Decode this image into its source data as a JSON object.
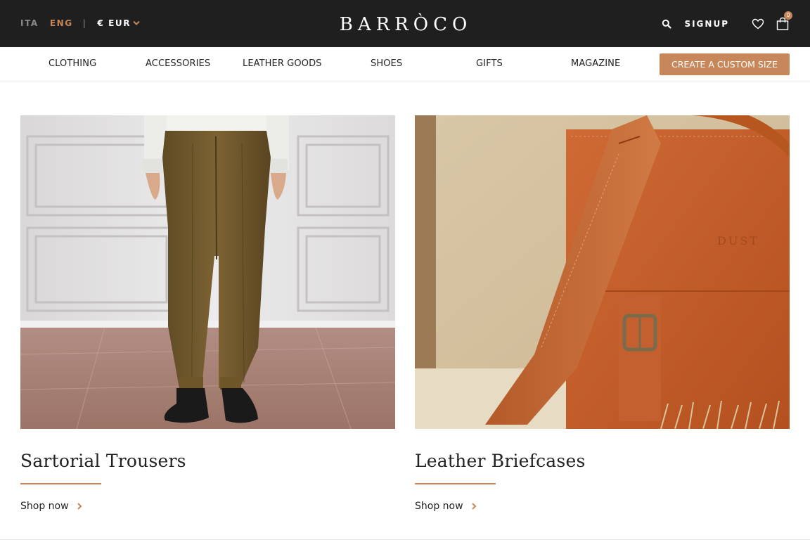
{
  "topbar": {
    "lang_ita": "ITA",
    "lang_eng": "ENG",
    "separator": "|",
    "currency": "€ EUR",
    "logo": "BARRÒCO",
    "signup": "SIGNUP",
    "cart_count": "0",
    "accent_color": "#c8875a"
  },
  "nav": {
    "items": [
      "CLOTHING",
      "ACCESSORIES",
      "LEATHER GOODS",
      "SHOES",
      "GIFTS",
      "MAGAZINE"
    ],
    "cta": "CREATE A CUSTOM SIZE"
  },
  "cards": [
    {
      "title": "Sartorial Trousers",
      "link": "Shop now"
    },
    {
      "title": "Leather Briefcases",
      "link": "Shop now",
      "bag_stamp": "DUST"
    }
  ],
  "icons": [
    "chevron-down-icon",
    "search-icon",
    "heart-icon",
    "bag-icon",
    "chevron-right-icon"
  ]
}
